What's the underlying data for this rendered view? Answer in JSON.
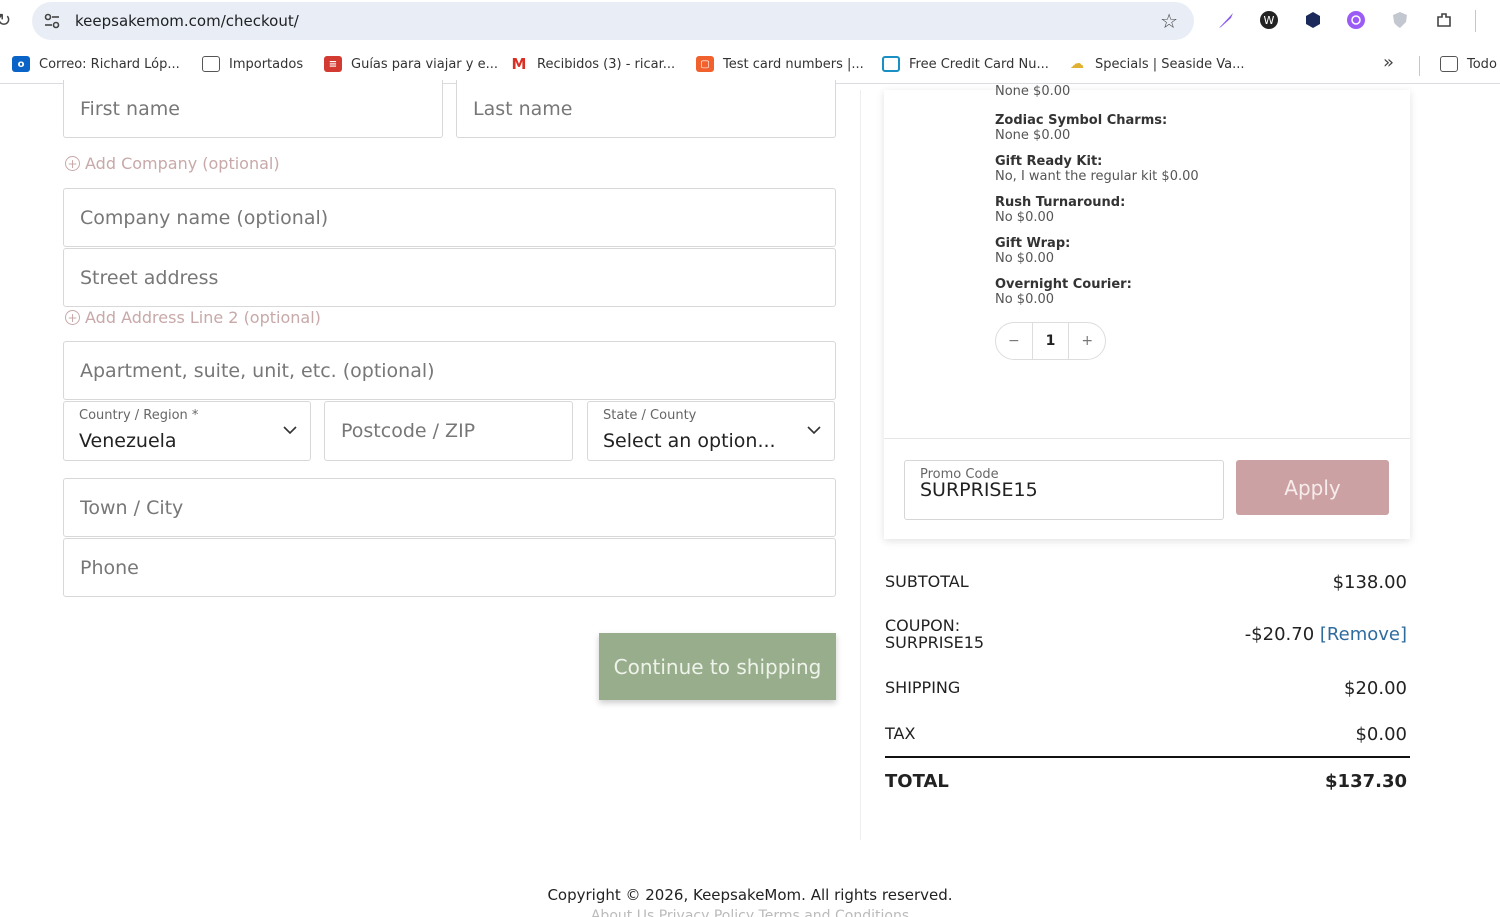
{
  "browser": {
    "url": "keepsakemom.com/checkout/",
    "bookmarks": [
      {
        "label": "Correo: Richard Lóp...",
        "icon": "outlook-icon"
      },
      {
        "label": "Importados",
        "icon": "folder-icon"
      },
      {
        "label": "Guías para viajar y e...",
        "icon": "guide-icon"
      },
      {
        "label": "Recibidos (3) - ricar...",
        "icon": "gmail-icon"
      },
      {
        "label": "Test card numbers |...",
        "icon": "card-icon"
      },
      {
        "label": "Free Credit Card Nu...",
        "icon": "credit-card-icon"
      },
      {
        "label": "Specials | Seaside Va...",
        "icon": "seaside-icon"
      },
      {
        "label": "Todo",
        "icon": "folder-icon"
      }
    ]
  },
  "form": {
    "first_name_placeholder": "First name",
    "last_name_placeholder": "Last name",
    "add_company": "Add Company (optional)",
    "company_placeholder": "Company name (optional)",
    "street_placeholder": "Street address",
    "add_address2": "Add Address Line 2 (optional)",
    "apartment_placeholder": "Apartment, suite, unit, etc. (optional)",
    "country_label": "Country / Region *",
    "country_value": "Venezuela",
    "postcode_placeholder": "Postcode / ZIP",
    "state_label": "State / County",
    "state_value": "Select an option...",
    "town_placeholder": "Town / City",
    "phone_placeholder": "Phone",
    "continue_label": "Continue to shipping"
  },
  "order": {
    "cut_line": "None $0.00",
    "options": [
      {
        "key": "Zodiac Symbol Charms:",
        "value": "None $0.00"
      },
      {
        "key": "Gift Ready Kit:",
        "value": "No, I want the regular kit $0.00"
      },
      {
        "key": "Rush Turnaround:",
        "value": "No $0.00"
      },
      {
        "key": "Gift Wrap:",
        "value": "No $0.00"
      },
      {
        "key": "Overnight Courier:",
        "value": "No $0.00"
      }
    ],
    "qty_minus": "−",
    "quantity": "1",
    "qty_plus": "+",
    "promo_label": "Promo Code",
    "promo_value": "SURPRISE15",
    "apply_label": "Apply"
  },
  "totals": {
    "subtotal_label": "SUBTOTAL",
    "subtotal": "$138.00",
    "coupon_label_1": "COUPON:",
    "coupon_label_2": "SURPRISE15",
    "coupon_amount": "-$20.70",
    "remove_label": "[Remove]",
    "shipping_label": "SHIPPING",
    "shipping": "$20.00",
    "tax_label": "TAX",
    "tax": "$0.00",
    "total_label": "TOTAL",
    "total": "$137.30"
  },
  "footer": {
    "copyright": "Copyright © 2026, KeepsakeMom. All rights reserved.",
    "links": "About Us   Privacy Policy   Terms and Conditions"
  }
}
